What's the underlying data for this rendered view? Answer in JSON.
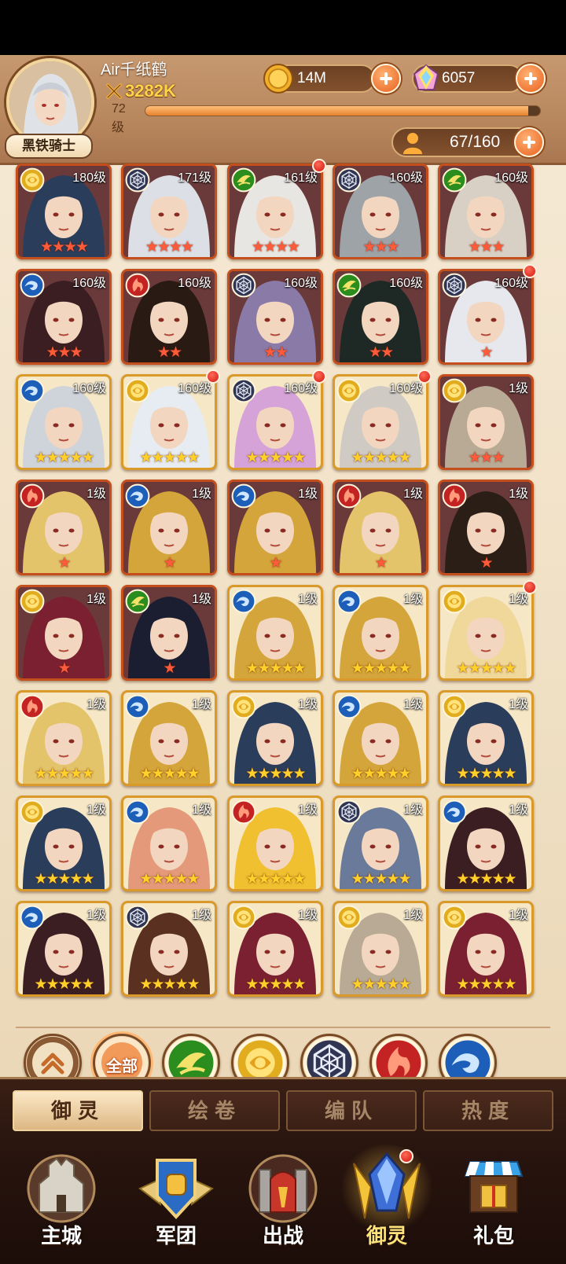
{
  "player": {
    "name": "Air千纸鹤",
    "power": "3282K",
    "level_label": "72级",
    "xp_progress": 0.97,
    "title_badge": "黑铁骑士"
  },
  "resources": {
    "gold": "14M",
    "crystal": "6057",
    "population": "67/160"
  },
  "cards": [
    {
      "level": "180级",
      "element": "rose",
      "stars": 4,
      "star_color": "red",
      "frame": "red",
      "red_dot": false
    },
    {
      "level": "171级",
      "element": "web",
      "stars": 4,
      "star_color": "red",
      "frame": "red",
      "red_dot": false
    },
    {
      "level": "161级",
      "element": "leaf",
      "stars": 4,
      "star_color": "red",
      "frame": "red",
      "red_dot": true
    },
    {
      "level": "160级",
      "element": "web",
      "stars": 3,
      "star_color": "red",
      "frame": "red",
      "red_dot": false
    },
    {
      "level": "160级",
      "element": "leaf",
      "stars": 3,
      "star_color": "red",
      "frame": "red",
      "red_dot": false
    },
    {
      "level": "160级",
      "element": "wave",
      "stars": 3,
      "star_color": "red",
      "frame": "red",
      "red_dot": false
    },
    {
      "level": "160级",
      "element": "flame",
      "stars": 2,
      "star_color": "red",
      "frame": "red",
      "red_dot": false
    },
    {
      "level": "160级",
      "element": "web",
      "stars": 2,
      "star_color": "red",
      "frame": "red",
      "red_dot": false
    },
    {
      "level": "160级",
      "element": "leaf",
      "stars": 2,
      "star_color": "red",
      "frame": "red",
      "red_dot": false
    },
    {
      "level": "160级",
      "element": "web",
      "stars": 1,
      "star_color": "red",
      "frame": "red",
      "red_dot": true
    },
    {
      "level": "160级",
      "element": "wave",
      "stars": 5,
      "star_color": "gold",
      "frame": "gold",
      "red_dot": false
    },
    {
      "level": "160级",
      "element": "rose",
      "stars": 5,
      "star_color": "gold",
      "frame": "gold",
      "red_dot": true
    },
    {
      "level": "160级",
      "element": "web",
      "stars": 5,
      "star_color": "gold",
      "frame": "gold",
      "red_dot": true
    },
    {
      "level": "160级",
      "element": "rose",
      "stars": 5,
      "star_color": "gold",
      "frame": "gold",
      "red_dot": true
    },
    {
      "level": "1级",
      "element": "rose",
      "stars": 3,
      "star_color": "red",
      "frame": "red",
      "red_dot": false
    },
    {
      "level": "1级",
      "element": "flame",
      "stars": 1,
      "star_color": "red",
      "frame": "red",
      "red_dot": false
    },
    {
      "level": "1级",
      "element": "wave",
      "stars": 1,
      "star_color": "red",
      "frame": "red",
      "red_dot": false
    },
    {
      "level": "1级",
      "element": "wave",
      "stars": 1,
      "star_color": "red",
      "frame": "red",
      "red_dot": false
    },
    {
      "level": "1级",
      "element": "flame",
      "stars": 1,
      "star_color": "red",
      "frame": "red",
      "red_dot": false
    },
    {
      "level": "1级",
      "element": "flame",
      "stars": 1,
      "star_color": "red",
      "frame": "red",
      "red_dot": false
    },
    {
      "level": "1级",
      "element": "rose",
      "stars": 1,
      "star_color": "red",
      "frame": "red",
      "red_dot": false
    },
    {
      "level": "1级",
      "element": "leaf",
      "stars": 1,
      "star_color": "red",
      "frame": "red",
      "red_dot": false
    },
    {
      "level": "1级",
      "element": "wave",
      "stars": 5,
      "star_color": "gold",
      "frame": "gold",
      "red_dot": false
    },
    {
      "level": "1级",
      "element": "wave",
      "stars": 5,
      "star_color": "gold",
      "frame": "gold",
      "red_dot": false
    },
    {
      "level": "1级",
      "element": "rose",
      "stars": 5,
      "star_color": "gold",
      "frame": "gold",
      "red_dot": true
    },
    {
      "level": "1级",
      "element": "flame",
      "stars": 5,
      "star_color": "gold",
      "frame": "gold",
      "red_dot": false
    },
    {
      "level": "1级",
      "element": "wave",
      "stars": 5,
      "star_color": "gold",
      "frame": "gold",
      "red_dot": false
    },
    {
      "level": "1级",
      "element": "rose",
      "stars": 5,
      "star_color": "gold",
      "frame": "gold",
      "red_dot": false
    },
    {
      "level": "1级",
      "element": "wave",
      "stars": 5,
      "star_color": "gold",
      "frame": "gold",
      "red_dot": false
    },
    {
      "level": "1级",
      "element": "rose",
      "stars": 5,
      "star_color": "gold",
      "frame": "gold",
      "red_dot": false
    },
    {
      "level": "1级",
      "element": "rose",
      "stars": 5,
      "star_color": "gold",
      "frame": "gold",
      "red_dot": false
    },
    {
      "level": "1级",
      "element": "wave",
      "stars": 5,
      "star_color": "gold",
      "frame": "gold",
      "red_dot": false
    },
    {
      "level": "1级",
      "element": "flame",
      "stars": 5,
      "star_color": "gold",
      "frame": "gold",
      "red_dot": false
    },
    {
      "level": "1级",
      "element": "web",
      "stars": 5,
      "star_color": "gold",
      "frame": "gold",
      "red_dot": false
    },
    {
      "level": "1级",
      "element": "wave",
      "stars": 5,
      "star_color": "gold",
      "frame": "gold",
      "red_dot": false
    },
    {
      "level": "1级",
      "element": "wave",
      "stars": 5,
      "star_color": "gold",
      "frame": "gold",
      "red_dot": false
    },
    {
      "level": "1级",
      "element": "web",
      "stars": 5,
      "star_color": "gold",
      "frame": "gold",
      "red_dot": false
    },
    {
      "level": "1级",
      "element": "rose",
      "stars": 5,
      "star_color": "gold",
      "frame": "gold",
      "red_dot": false
    },
    {
      "level": "1级",
      "element": "rose",
      "stars": 5,
      "star_color": "gold",
      "frame": "gold",
      "red_dot": false
    },
    {
      "level": "1级",
      "element": "rose",
      "stars": 5,
      "star_color": "gold",
      "frame": "gold",
      "red_dot": false
    }
  ],
  "filters": [
    {
      "icon": "collapse-chevrons-icon"
    },
    {
      "icon": "all-filter-icon",
      "label": "全部",
      "selected": true
    },
    {
      "icon": "leaf-element-icon"
    },
    {
      "icon": "rose-element-icon"
    },
    {
      "icon": "web-element-icon"
    },
    {
      "icon": "flame-element-icon"
    },
    {
      "icon": "wave-element-icon"
    }
  ],
  "subtabs": [
    "御灵",
    "绘卷",
    "编队",
    "热度"
  ],
  "active_subtab": "御灵",
  "nav": [
    {
      "label": "主城",
      "icon": "city-icon"
    },
    {
      "label": "军团",
      "icon": "legion-fist-icon"
    },
    {
      "label": "出战",
      "icon": "battle-gate-icon"
    },
    {
      "label": "御灵",
      "icon": "crystal-spirit-icon",
      "active": true,
      "red_dot": true
    },
    {
      "label": "礼包",
      "icon": "gift-shop-icon"
    }
  ],
  "colors": {
    "leaf": "#2a8d1d",
    "rose": "#e1ac1d",
    "web": "#2f3552",
    "flame": "#c42323",
    "wave": "#1d5fb8",
    "accent_orange": "#e8611e"
  }
}
